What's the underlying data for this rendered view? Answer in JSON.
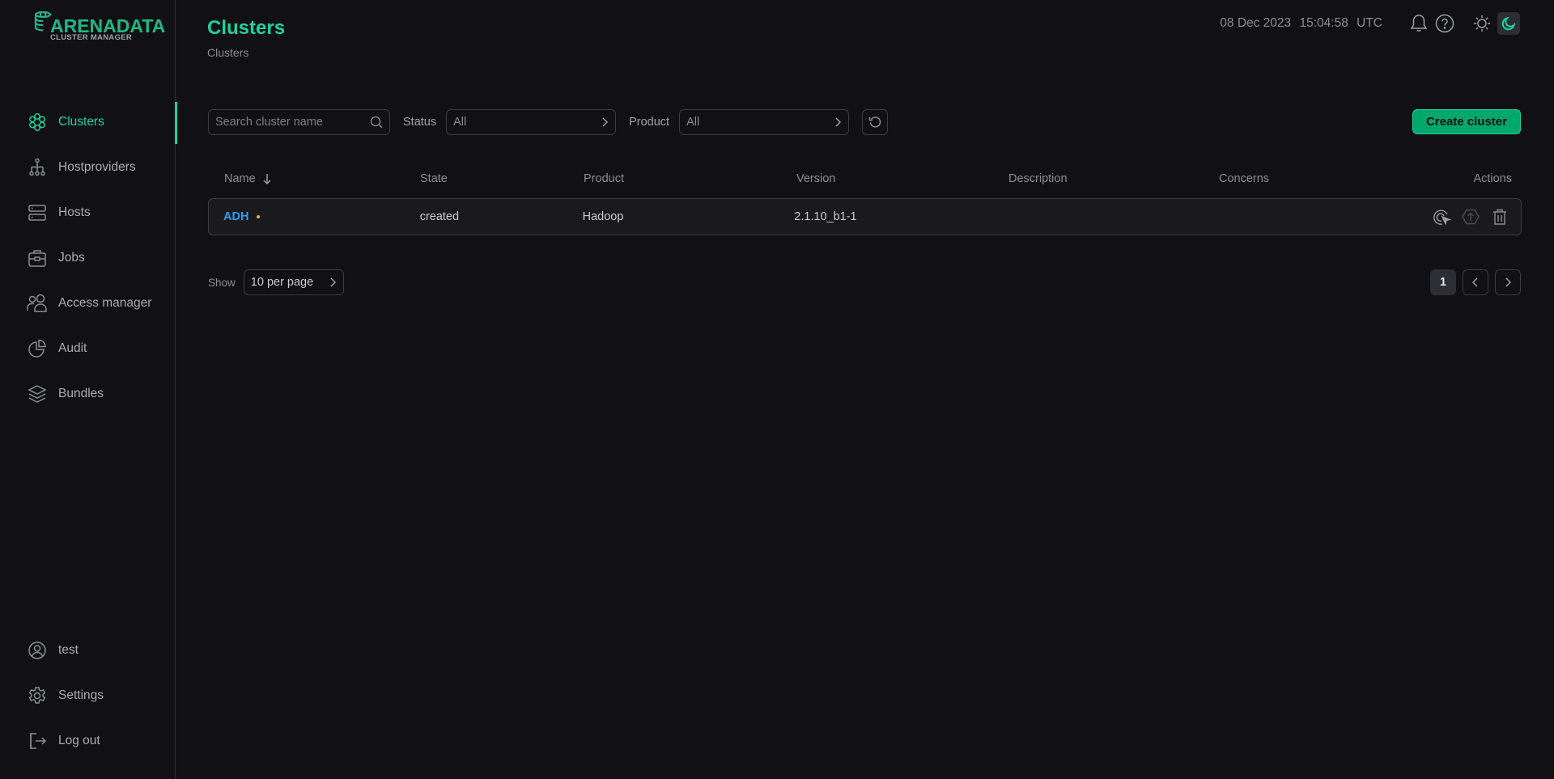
{
  "brand": {
    "title": "ARENADATA",
    "subtitle": "CLUSTER MANAGER",
    "accent_color": "#1ed39c"
  },
  "sidebar": {
    "items": [
      {
        "label": "Clusters",
        "icon": "clusters-icon",
        "active": true
      },
      {
        "label": "Hostproviders",
        "icon": "hostproviders-icon",
        "active": false
      },
      {
        "label": "Hosts",
        "icon": "hosts-icon",
        "active": false
      },
      {
        "label": "Jobs",
        "icon": "jobs-icon",
        "active": false
      },
      {
        "label": "Access manager",
        "icon": "access-manager-icon",
        "active": false
      },
      {
        "label": "Audit",
        "icon": "audit-icon",
        "active": false
      },
      {
        "label": "Bundles",
        "icon": "bundles-icon",
        "active": false
      }
    ],
    "bottom_items": [
      {
        "label": "test",
        "icon": "user-icon"
      },
      {
        "label": "Settings",
        "icon": "gear-icon"
      },
      {
        "label": "Log out",
        "icon": "logout-icon"
      }
    ]
  },
  "header": {
    "title": "Clusters",
    "breadcrumb": "Clusters",
    "date": "08 Dec 2023",
    "time": "15:04:58",
    "timezone": "UTC",
    "icons": [
      "bell-icon",
      "help-icon",
      "sun-icon",
      "moon-icon"
    ],
    "theme": "dark"
  },
  "filters": {
    "search_placeholder": "Search cluster name",
    "search_value": "",
    "status_label": "Status",
    "status_value": "All",
    "product_label": "Product",
    "product_value": "All",
    "reset_icon": "reset-icon"
  },
  "toolbar": {
    "create_label": "Create cluster"
  },
  "table": {
    "columns": [
      "Name",
      "State",
      "Product",
      "Version",
      "Description",
      "Concerns",
      "Actions"
    ],
    "sort": {
      "column": "Name",
      "direction": "desc"
    },
    "rows": [
      {
        "name": "ADH",
        "has_concern": true,
        "state": "created",
        "product": "Hadoop",
        "version": "2.1.10_b1-1",
        "description": "",
        "concerns": "",
        "actions": [
          "run-action-icon",
          "upgrade-icon",
          "delete-icon"
        ]
      }
    ]
  },
  "pagination": {
    "show_label": "Show",
    "per_page": "10 per page",
    "current_page": "1"
  }
}
